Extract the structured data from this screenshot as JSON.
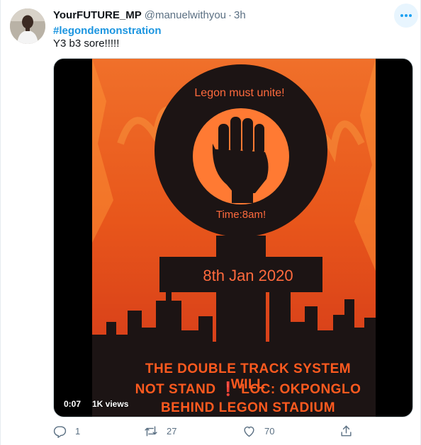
{
  "tweet": {
    "display_name": "YourFUTURE_MP",
    "handle": "@manuelwithyou",
    "separator": "·",
    "time": "3h",
    "hashtag": "#legondemonstration",
    "text": "Y3 b3 sore!!!!!",
    "more_icon": "more-options-icon"
  },
  "media": {
    "type": "video",
    "poster_lines": {
      "unite": "Legon must unite!",
      "time": "Time:8am!",
      "date": "8th Jan 2020",
      "caption_1": "THE DOUBLE TRACK SYSTEM WILL",
      "caption_2_a": "NOT STAND",
      "caption_2_icon": "❗",
      "caption_2_b": "LOC: OKPONGLO",
      "caption_3": "BEHIND LEGON STADIUM"
    },
    "duration": "0:07",
    "views": "1K views"
  },
  "actions": {
    "reply_count": "1",
    "retweet_count": "27",
    "like_count": "70",
    "icons": [
      "reply-icon",
      "retweet-icon",
      "like-icon",
      "share-icon"
    ]
  },
  "colors": {
    "link": "#1b95e0",
    "secondary_text": "#5b7083",
    "poster_text": "#ff6a3d",
    "fire": "#e8561b"
  }
}
